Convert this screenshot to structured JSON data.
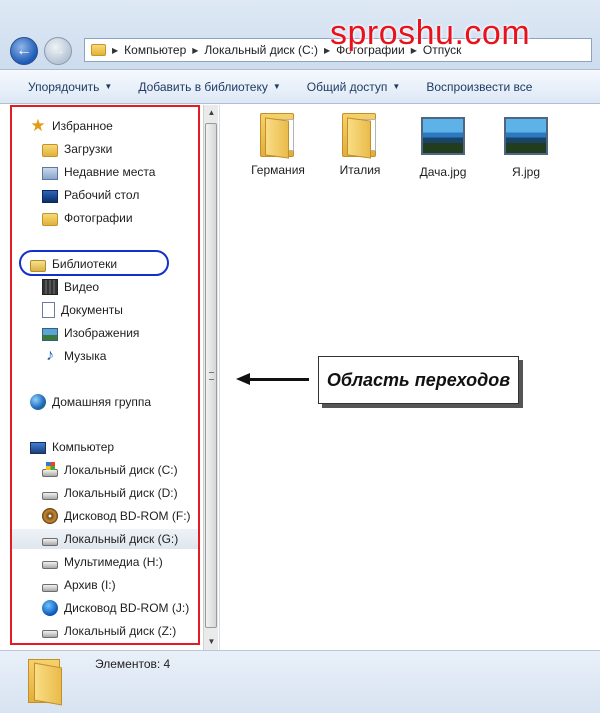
{
  "watermark": "sproshu.com",
  "address": {
    "crumbs": [
      "Компьютер",
      "Локальный диск (C:)",
      "Фотографии",
      "Отпуск"
    ]
  },
  "toolbar": {
    "organize": "Упорядочить",
    "add_library": "Добавить в библиотеку",
    "share": "Общий доступ",
    "play_all": "Воспроизвести все"
  },
  "nav": {
    "favorites": "Избранное",
    "downloads": "Загрузки",
    "recent": "Недавние места",
    "desktop": "Рабочий стол",
    "photos": "Фотографии",
    "libraries": "Библиотеки",
    "video": "Видео",
    "documents": "Документы",
    "images": "Изображения",
    "music": "Музыка",
    "homegroup": "Домашняя группа",
    "computer": "Компьютер",
    "drive_c": "Локальный диск (C:)",
    "drive_d": "Локальный диск (D:)",
    "drive_f": "Дисковод BD-ROM (F:)",
    "drive_g": "Локальный диск (G:)",
    "drive_h": "Мультимедиа (H:)",
    "drive_i": "Архив (I:)",
    "drive_j": "Дисковод BD-ROM (J:)",
    "drive_z": "Локальный диск (Z:)"
  },
  "files": [
    {
      "name": "Германия",
      "icon": "folder-icon"
    },
    {
      "name": "Италия",
      "icon": "folder-icon"
    },
    {
      "name": "Дача.jpg",
      "icon": "image-thumbnail"
    },
    {
      "name": "Я.jpg",
      "icon": "image-thumbnail"
    }
  ],
  "callout": "Область переходов",
  "details": {
    "count": "Элементов: 4"
  },
  "colors": {
    "highlight_frame": "#e11c22",
    "oval": "#1330c9",
    "watermark": "#e8121c"
  }
}
